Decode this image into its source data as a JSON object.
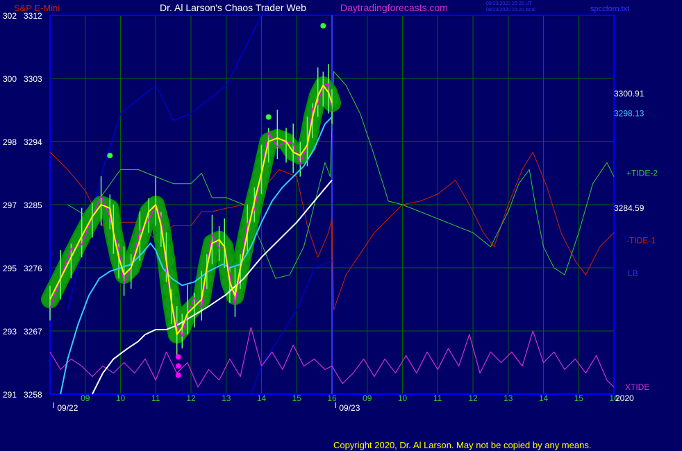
{
  "header": {
    "instrument": "S&P E-Mini",
    "title": "Dr. Al Larson's Chaos Trader Web",
    "site": "Daytradingforecasts.com",
    "time_ut": "09/23/2020 20:20 UT",
    "time_local": "09/23/2020 15:20 local",
    "filename": "spccforn.txt"
  },
  "footer": {
    "copyright": "Copyright 2020, Dr. Al Larson. May not be copied by any means."
  },
  "colors": {
    "background": "#000066",
    "axis": "#0000ff",
    "grid": "#006600",
    "price": "#ffff00",
    "price_raw": "#ff00ff",
    "glow": "#009900",
    "fast_ma": "#33ccff",
    "slow_ma": "#ffffff",
    "tide_plus": "#33cc33",
    "tide_minus": "#cc2200",
    "band": "#0000cc",
    "xtide": "#cc33cc"
  },
  "chart_data": {
    "type": "line",
    "title": "S&P E-Mini",
    "y_left_ticks": [
      {
        "ref": "302",
        "price": 3312
      },
      {
        "ref": "300",
        "price": 3303
      },
      {
        "ref": "298",
        "price": 3294
      },
      {
        "ref": "297",
        "price": 3285
      },
      {
        "ref": "295",
        "price": 3276
      },
      {
        "ref": "293",
        "price": 3267
      },
      {
        "ref": "291",
        "price": 3258
      }
    ],
    "ylim": [
      3258,
      3312
    ],
    "x_ticks": [
      "09",
      "10",
      "11",
      "12",
      "13",
      "14",
      "15",
      "16",
      "09",
      "10",
      "11",
      "12",
      "13",
      "14",
      "15",
      "16"
    ],
    "x_tick_hours": [
      9,
      10,
      11,
      12,
      13,
      14,
      15,
      16,
      17,
      18,
      19,
      20,
      21,
      22,
      23,
      24
    ],
    "date_labels": [
      {
        "label": "09/22",
        "hour": 8.5
      },
      {
        "label": "09/23",
        "hour": 16.5
      }
    ],
    "year_label": "2020",
    "xlim": [
      8,
      24
    ],
    "now_hour": 16,
    "right_labels": [
      {
        "text": "3300.91",
        "price": 3300.9,
        "color": "#ffffff"
      },
      {
        "text": "3298.13",
        "price": 3298.1,
        "color": "#33ccff"
      },
      {
        "text": "+TIDE-2",
        "price": 3289.6,
        "color": "#33cc33"
      },
      {
        "text": "3284.59",
        "price": 3284.6,
        "color": "#ffffff"
      },
      {
        "text": "-TIDE-1",
        "price": 3280.0,
        "color": "#cc2200"
      },
      {
        "text": "LB",
        "price": 3275.3,
        "color": "#3333ff"
      },
      {
        "text": "XTIDE",
        "price": 3259.1,
        "color": "#cc33cc"
      }
    ],
    "series": [
      {
        "key": "price",
        "label": "S&P E-Mini",
        "points": [
          [
            8,
            3271.5
          ],
          [
            8.3,
            3274.5
          ],
          [
            8.6,
            3277.5
          ],
          [
            8.9,
            3280.5
          ],
          [
            9.2,
            3283.3
          ],
          [
            9.45,
            3285
          ],
          [
            9.7,
            3284.5
          ],
          [
            9.8,
            3281
          ],
          [
            9.95,
            3277.5
          ],
          [
            10.1,
            3275
          ],
          [
            10.3,
            3276
          ],
          [
            10.55,
            3280
          ],
          [
            10.8,
            3284
          ],
          [
            11.0,
            3285
          ],
          [
            11.15,
            3282
          ],
          [
            11.3,
            3277
          ],
          [
            11.45,
            3271
          ],
          [
            11.6,
            3266.5
          ],
          [
            11.75,
            3267.5
          ],
          [
            11.9,
            3269.5
          ],
          [
            12.1,
            3270.5
          ],
          [
            12.3,
            3271.5
          ],
          [
            12.45,
            3276
          ],
          [
            12.6,
            3279.5
          ],
          [
            12.8,
            3280
          ],
          [
            12.95,
            3279
          ],
          [
            13.1,
            3274
          ],
          [
            13.25,
            3272
          ],
          [
            13.4,
            3276
          ],
          [
            13.6,
            3281
          ],
          [
            13.8,
            3285.5
          ],
          [
            14.0,
            3289.5
          ],
          [
            14.2,
            3294
          ],
          [
            14.45,
            3294.5
          ],
          [
            14.7,
            3294
          ],
          [
            14.9,
            3292.5
          ],
          [
            15.1,
            3292
          ],
          [
            15.3,
            3293.5
          ],
          [
            15.45,
            3297.5
          ],
          [
            15.6,
            3300.5
          ],
          [
            15.75,
            3302
          ],
          [
            15.9,
            3301
          ],
          [
            16.0,
            3299.5
          ]
        ]
      },
      {
        "key": "fast_ma",
        "label": "3298.13",
        "points": [
          [
            8.3,
            3258
          ],
          [
            8.5,
            3263
          ],
          [
            8.8,
            3268
          ],
          [
            9.1,
            3272
          ],
          [
            9.4,
            3274.5
          ],
          [
            9.7,
            3275.5
          ],
          [
            10.0,
            3276
          ],
          [
            10.3,
            3276.5
          ],
          [
            10.6,
            3278
          ],
          [
            10.85,
            3279.5
          ],
          [
            11.0,
            3278.5
          ],
          [
            11.2,
            3276
          ],
          [
            11.45,
            3274.5
          ],
          [
            11.75,
            3273.5
          ],
          [
            12.1,
            3274
          ],
          [
            12.5,
            3275.5
          ],
          [
            12.9,
            3276.5
          ],
          [
            13.1,
            3276
          ],
          [
            13.4,
            3276.5
          ],
          [
            13.7,
            3279
          ],
          [
            14.0,
            3282.5
          ],
          [
            14.3,
            3285.5
          ],
          [
            14.6,
            3287.5
          ],
          [
            14.9,
            3289
          ],
          [
            15.2,
            3290.5
          ],
          [
            15.5,
            3293
          ],
          [
            15.8,
            3296.5
          ],
          [
            16.0,
            3297.5
          ]
        ]
      },
      {
        "key": "slow_ma",
        "label": "3300.91",
        "points": [
          [
            9.2,
            3258
          ],
          [
            9.5,
            3261
          ],
          [
            9.8,
            3263
          ],
          [
            10.2,
            3264.5
          ],
          [
            10.5,
            3265.5
          ],
          [
            10.7,
            3266.5
          ],
          [
            11.0,
            3267.2
          ],
          [
            11.3,
            3267.2
          ],
          [
            11.6,
            3267.8
          ],
          [
            12.0,
            3269
          ],
          [
            12.5,
            3270.5
          ],
          [
            13.0,
            3272.2
          ],
          [
            13.5,
            3274.5
          ],
          [
            14.0,
            3277.5
          ],
          [
            14.5,
            3280
          ],
          [
            15.0,
            3282.5
          ],
          [
            15.5,
            3285.5
          ],
          [
            16.0,
            3288.5
          ]
        ]
      },
      {
        "key": "tide_plus",
        "label": "+TIDE-2",
        "points": [
          [
            8.5,
            3285
          ],
          [
            9,
            3283.5
          ],
          [
            9.5,
            3286.5
          ],
          [
            10,
            3290
          ],
          [
            10.5,
            3290
          ],
          [
            11,
            3289
          ],
          [
            11.5,
            3288
          ],
          [
            12,
            3288
          ],
          [
            12.3,
            3289.5
          ],
          [
            12.6,
            3286
          ],
          [
            13,
            3286
          ],
          [
            13.5,
            3285
          ],
          [
            14,
            3279.5
          ],
          [
            14.4,
            3274.5
          ],
          [
            14.8,
            3275
          ],
          [
            15.2,
            3279
          ],
          [
            15.5,
            3285
          ],
          [
            15.8,
            3291
          ],
          [
            15.95,
            3289
          ],
          [
            16.05,
            3304
          ],
          [
            16.4,
            3302
          ],
          [
            16.8,
            3298
          ],
          [
            17.2,
            3292
          ],
          [
            17.6,
            3285.5
          ],
          [
            18,
            3285
          ],
          [
            18.5,
            3284
          ],
          [
            19,
            3283
          ],
          [
            19.5,
            3282
          ],
          [
            20,
            3281
          ],
          [
            20.5,
            3279
          ],
          [
            21,
            3284
          ],
          [
            21.3,
            3288
          ],
          [
            21.6,
            3290
          ],
          [
            21.8,
            3284
          ],
          [
            22,
            3279
          ],
          [
            22.3,
            3276
          ],
          [
            22.6,
            3275
          ],
          [
            23,
            3281
          ],
          [
            23.4,
            3288
          ],
          [
            23.8,
            3291
          ],
          [
            24,
            3289
          ]
        ]
      },
      {
        "key": "tide_minus",
        "label": "-TIDE-1",
        "points": [
          [
            8.0,
            3292.5
          ],
          [
            8.5,
            3290
          ],
          [
            9,
            3287
          ],
          [
            9.5,
            3282
          ],
          [
            10,
            3282.5
          ],
          [
            10.5,
            3282.5
          ],
          [
            11,
            3280
          ],
          [
            11.5,
            3282
          ],
          [
            12,
            3282
          ],
          [
            12.3,
            3284
          ],
          [
            12.6,
            3284
          ],
          [
            13,
            3284.5
          ],
          [
            13.5,
            3285
          ],
          [
            14,
            3287
          ],
          [
            14.5,
            3290
          ],
          [
            15,
            3289
          ],
          [
            15.3,
            3282
          ],
          [
            15.6,
            3277.5
          ],
          [
            15.9,
            3281
          ],
          [
            16.0,
            3283
          ],
          [
            16.05,
            3270
          ],
          [
            16.4,
            3275
          ],
          [
            16.8,
            3278
          ],
          [
            17.2,
            3281
          ],
          [
            17.6,
            3283
          ],
          [
            18,
            3285
          ],
          [
            18.5,
            3285.5
          ],
          [
            19,
            3286.5
          ],
          [
            19.5,
            3288.5
          ],
          [
            19.9,
            3285
          ],
          [
            20.3,
            3281
          ],
          [
            20.6,
            3279
          ],
          [
            21,
            3285
          ],
          [
            21.4,
            3290
          ],
          [
            21.7,
            3292.5
          ],
          [
            22.1,
            3287.5
          ],
          [
            22.5,
            3281
          ],
          [
            22.9,
            3277
          ],
          [
            23.2,
            3275
          ],
          [
            23.6,
            3279
          ],
          [
            24,
            3281
          ]
        ]
      },
      {
        "key": "band",
        "label": "LB",
        "points": [
          [
            8.5,
            3270
          ],
          [
            9,
            3280
          ],
          [
            9.5,
            3290
          ],
          [
            10,
            3298
          ],
          [
            10.5,
            3300
          ],
          [
            11,
            3302
          ],
          [
            11.5,
            3297
          ],
          [
            12,
            3298
          ],
          [
            12.5,
            3300
          ],
          [
            13,
            3302
          ],
          [
            13.5,
            3307
          ],
          [
            14,
            3312
          ],
          [
            14.5,
            3316
          ],
          [
            15,
            3317
          ],
          [
            15.5,
            3318
          ],
          [
            16,
            3319
          ]
        ]
      },
      {
        "key": "band_lower",
        "label": "LB lower",
        "points": [
          [
            13.7,
            3258
          ],
          [
            14,
            3262
          ],
          [
            14.5,
            3266
          ],
          [
            15,
            3270
          ],
          [
            15.5,
            3276
          ],
          [
            16,
            3277
          ]
        ]
      },
      {
        "key": "xtide",
        "label": "XTIDE",
        "points": [
          [
            8,
            3264
          ],
          [
            8.3,
            3261.5
          ],
          [
            8.6,
            3263
          ],
          [
            8.9,
            3262
          ],
          [
            9.2,
            3260.5
          ],
          [
            9.5,
            3262
          ],
          [
            9.8,
            3261
          ],
          [
            10.1,
            3262.5
          ],
          [
            10.4,
            3261
          ],
          [
            10.7,
            3263
          ],
          [
            11,
            3260
          ],
          [
            11.3,
            3264
          ],
          [
            11.6,
            3261
          ],
          [
            11.9,
            3262.5
          ],
          [
            12.2,
            3259
          ],
          [
            12.5,
            3261.5
          ],
          [
            12.8,
            3260
          ],
          [
            13.1,
            3263
          ],
          [
            13.4,
            3260.5
          ],
          [
            13.7,
            3267.5
          ],
          [
            14.0,
            3262
          ],
          [
            14.3,
            3264
          ],
          [
            14.6,
            3261.5
          ],
          [
            14.9,
            3265
          ],
          [
            15.2,
            3262
          ],
          [
            15.5,
            3263
          ],
          [
            15.8,
            3261.5
          ],
          [
            16.0,
            3262
          ],
          [
            16.3,
            3259.5
          ],
          [
            16.6,
            3261
          ],
          [
            16.9,
            3263
          ],
          [
            17.2,
            3260.5
          ],
          [
            17.5,
            3263
          ],
          [
            17.8,
            3261
          ],
          [
            18.1,
            3263.5
          ],
          [
            18.4,
            3261
          ],
          [
            18.7,
            3264
          ],
          [
            19.0,
            3261.5
          ],
          [
            19.3,
            3264.5
          ],
          [
            19.6,
            3262
          ],
          [
            19.9,
            3266.5
          ],
          [
            20.2,
            3261
          ],
          [
            20.5,
            3264
          ],
          [
            20.8,
            3262.5
          ],
          [
            21.1,
            3264
          ],
          [
            21.4,
            3262
          ],
          [
            21.7,
            3267
          ],
          [
            22.0,
            3262.5
          ],
          [
            22.3,
            3264
          ],
          [
            22.6,
            3261.5
          ],
          [
            22.9,
            3263
          ],
          [
            23.2,
            3261
          ],
          [
            23.5,
            3263.5
          ],
          [
            23.8,
            3260
          ],
          [
            24,
            3259
          ]
        ]
      }
    ]
  }
}
